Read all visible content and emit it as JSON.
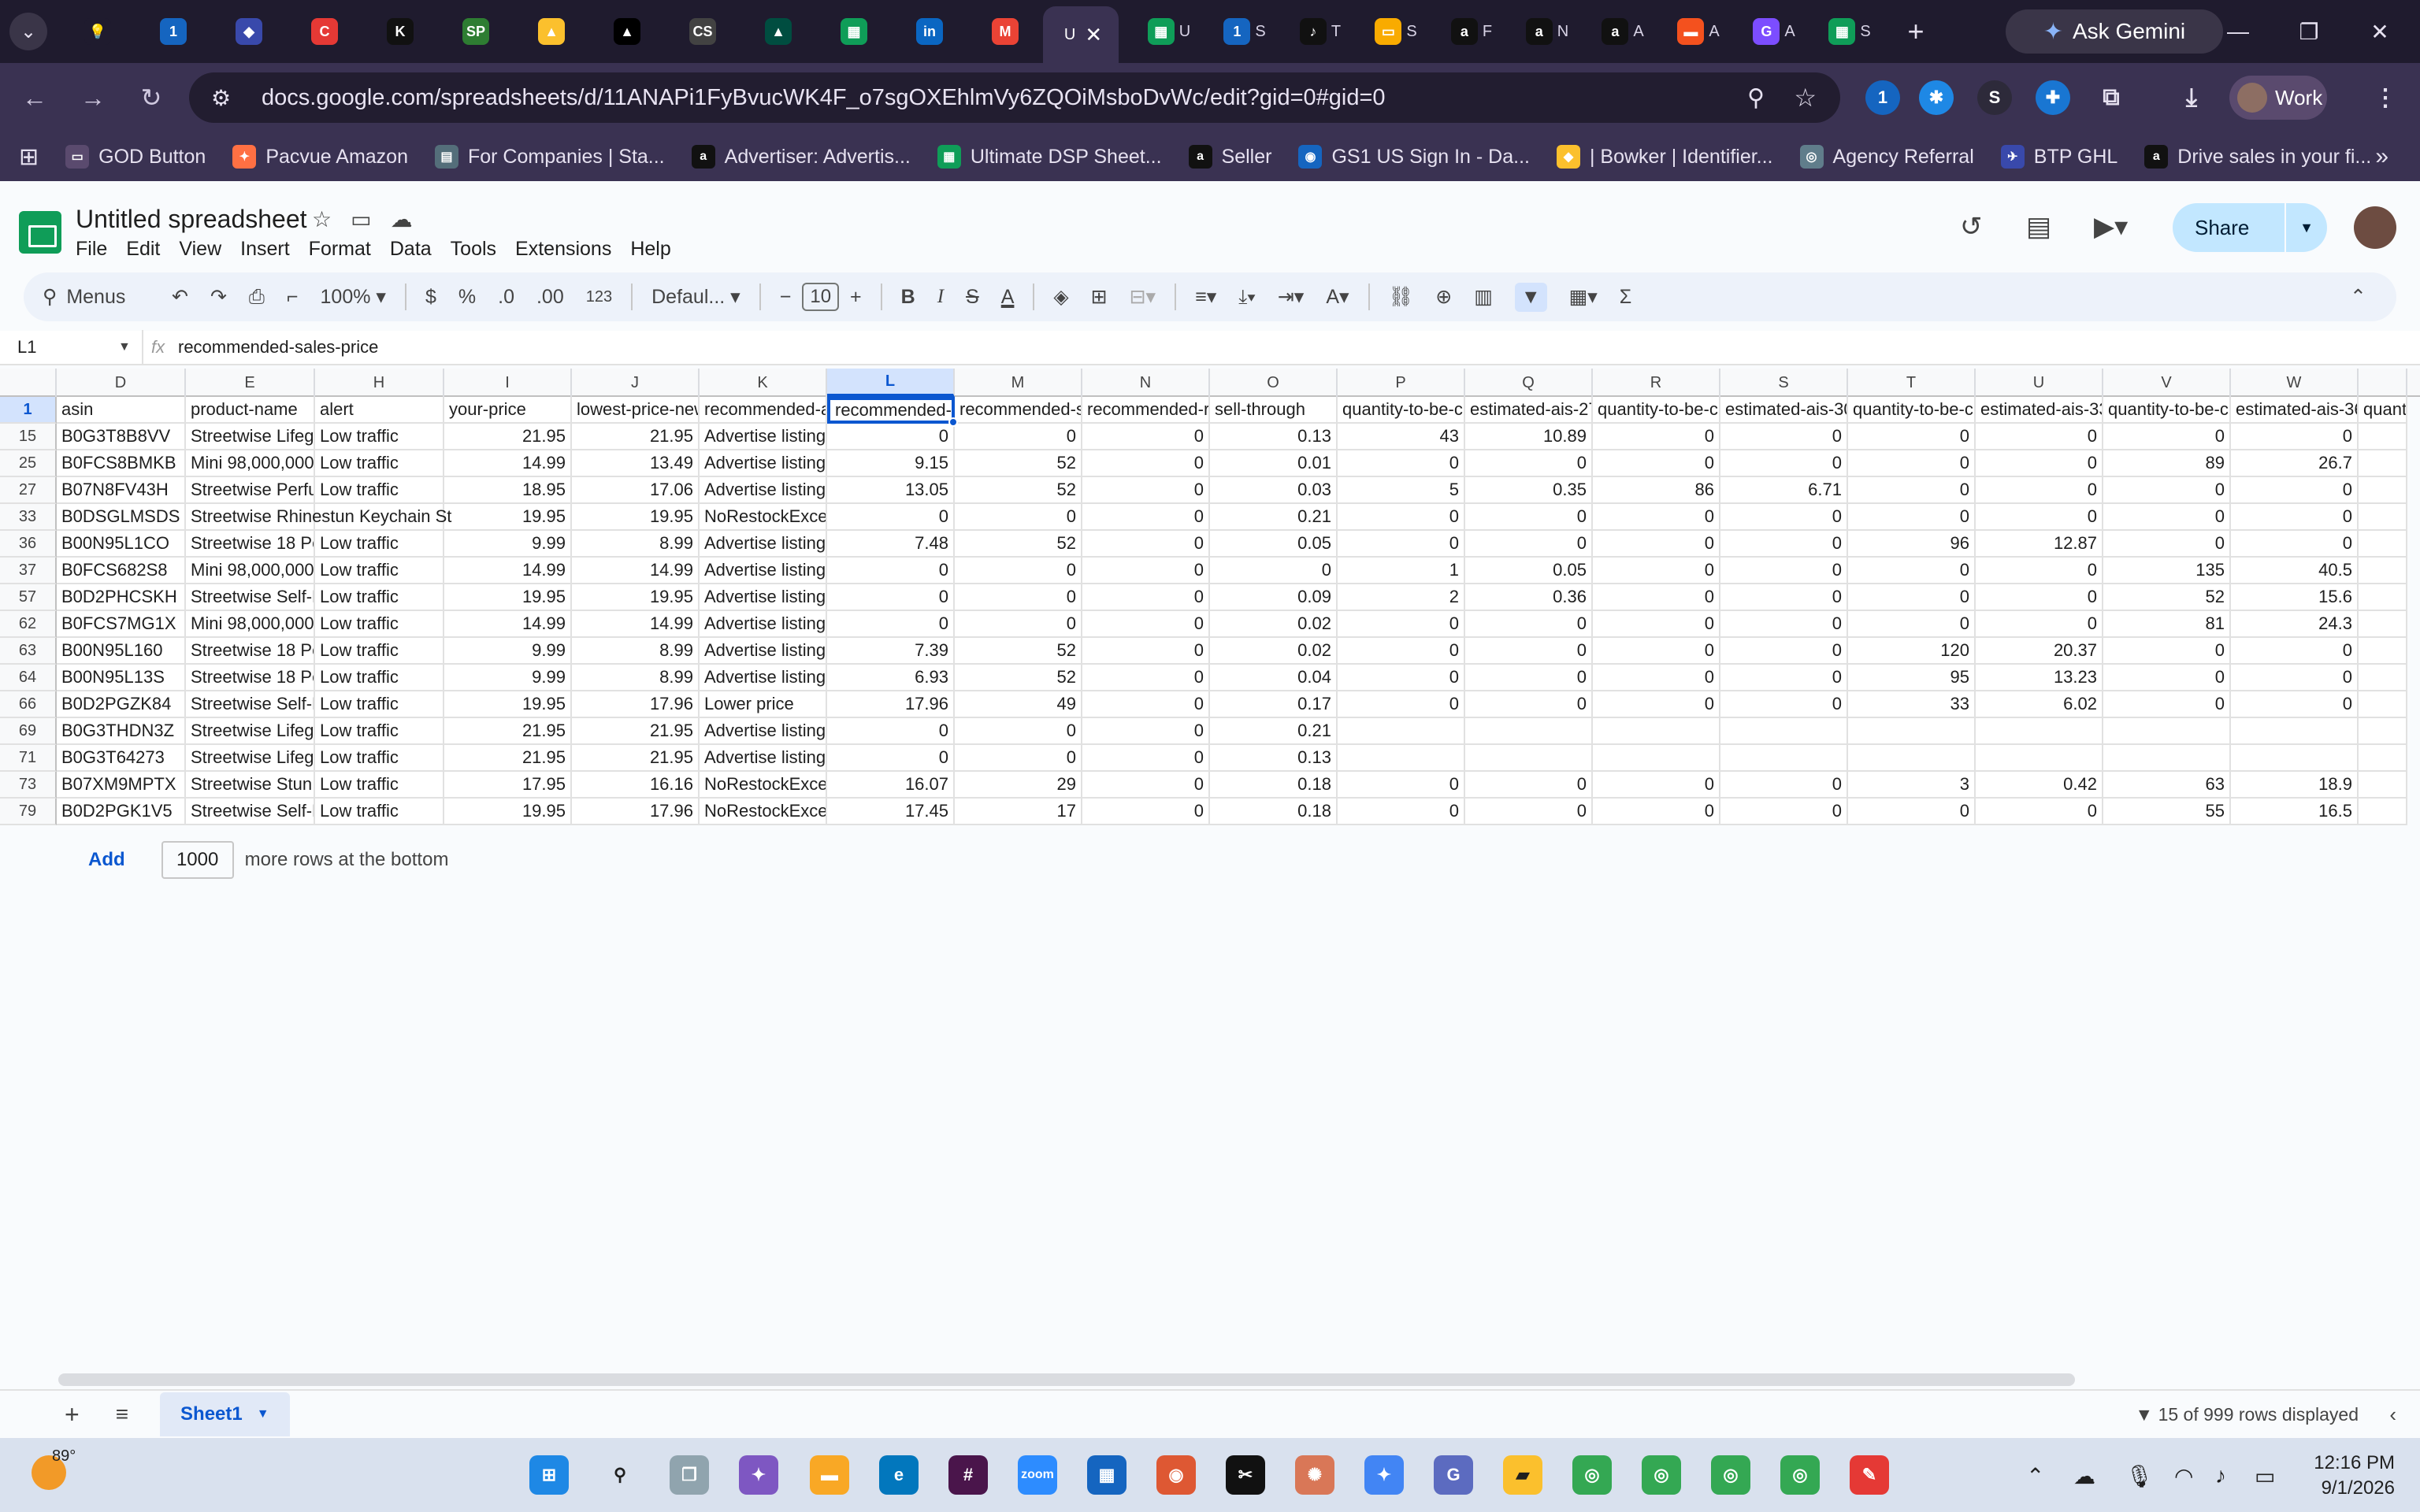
{
  "browser": {
    "tabs": [
      {
        "fav": "💡",
        "bg": "#1f1b2e",
        "title": ""
      },
      {
        "fav": "1",
        "bg": "#1565c0",
        "title": ""
      },
      {
        "fav": "◆",
        "bg": "#3949ab",
        "title": ""
      },
      {
        "fav": "C",
        "bg": "#e53935",
        "title": ""
      },
      {
        "fav": "K",
        "bg": "#111111",
        "title": ""
      },
      {
        "fav": "SP",
        "bg": "#2e7d32",
        "title": ""
      },
      {
        "fav": "▲",
        "bg": "#fbc02d",
        "title": ""
      },
      {
        "fav": "▲",
        "bg": "#000000",
        "title": ""
      },
      {
        "fav": "CS",
        "bg": "#424242",
        "title": ""
      },
      {
        "fav": "▲",
        "bg": "#004d40",
        "title": ""
      },
      {
        "fav": "▦",
        "bg": "#0f9d58",
        "title": ""
      },
      {
        "fav": "in",
        "bg": "#0a66c2",
        "title": ""
      },
      {
        "fav": "M",
        "bg": "#ea4335",
        "title": ""
      }
    ],
    "active_tab": {
      "title": "U",
      "close": "✕"
    },
    "tabs_after": [
      {
        "fav": "▦",
        "bg": "#0f9d58",
        "title": "U"
      },
      {
        "fav": "1",
        "bg": "#1565c0",
        "title": "S"
      },
      {
        "fav": "♪",
        "bg": "#111111",
        "title": "T"
      },
      {
        "fav": "▭",
        "bg": "#f9ab00",
        "title": "S"
      },
      {
        "fav": "a",
        "bg": "#111111",
        "title": "F"
      },
      {
        "fav": "a",
        "bg": "#111111",
        "title": "N"
      },
      {
        "fav": "a",
        "bg": "#111111",
        "title": "A"
      },
      {
        "fav": "▬",
        "bg": "#f4511e",
        "title": "A"
      },
      {
        "fav": "G",
        "bg": "#7c4dff",
        "title": "A"
      },
      {
        "fav": "▦",
        "bg": "#0f9d58",
        "title": "S"
      }
    ],
    "new_tab": "+",
    "ask_gemini": "Ask Gemini",
    "url": "docs.google.com/spreadsheets/d/11ANAPi1FyBvucWK4F_o7sgOXEhlmVy6ZQOiMsboDvWc/edit?gid=0#gid=0",
    "profile": "Work",
    "bookmarks": [
      {
        "label": "GOD Button",
        "bg": "#5a4a6e",
        "icon": "▭"
      },
      {
        "label": "Pacvue Amazon",
        "bg": "#ff7043",
        "icon": "✦"
      },
      {
        "label": "For Companies | Sta...",
        "bg": "#546e7a",
        "icon": "▤"
      },
      {
        "label": "Advertiser: Advertis...",
        "bg": "#111111",
        "icon": "a"
      },
      {
        "label": "Ultimate DSP Sheet...",
        "bg": "#0f9d58",
        "icon": "▦"
      },
      {
        "label": "Seller",
        "bg": "#111111",
        "icon": "a"
      },
      {
        "label": "GS1 US Sign In - Da...",
        "bg": "#1565c0",
        "icon": "◉"
      },
      {
        "label": "| Bowker | Identifier...",
        "bg": "#fbc02d",
        "icon": "◆"
      },
      {
        "label": "Agency Referral",
        "bg": "#607d8b",
        "icon": "◎"
      },
      {
        "label": "BTP GHL",
        "bg": "#3949ab",
        "icon": "✈"
      },
      {
        "label": "Drive sales in your fi...",
        "bg": "#111111",
        "icon": "a"
      }
    ]
  },
  "sheets": {
    "title": "Untitled spreadsheet",
    "menu": [
      "File",
      "Edit",
      "View",
      "Insert",
      "Format",
      "Data",
      "Tools",
      "Extensions",
      "Help"
    ],
    "share": "Share",
    "toolbar": {
      "menus": "Menus",
      "zoom": "100%",
      "currency": "$",
      "percent": "%",
      "dec_decrease": ".0",
      "dec_increase": ".00",
      "number_format": "123",
      "font": "Defaul...",
      "font_size": "10",
      "bold": "B",
      "italic": "I",
      "strike": "S",
      "text_color": "A"
    },
    "name_box": "L1",
    "fx": "fx",
    "formula": "recommended-sales-price",
    "columns": [
      {
        "letter": "D",
        "w": 164
      },
      {
        "letter": "E",
        "w": 164
      },
      {
        "letter": "H",
        "w": 164
      },
      {
        "letter": "I",
        "w": 162
      },
      {
        "letter": "J",
        "w": 162
      },
      {
        "letter": "K",
        "w": 162
      },
      {
        "letter": "L",
        "w": 162
      },
      {
        "letter": "M",
        "w": 162
      },
      {
        "letter": "N",
        "w": 162
      },
      {
        "letter": "O",
        "w": 162
      },
      {
        "letter": "P",
        "w": 162
      },
      {
        "letter": "Q",
        "w": 162
      },
      {
        "letter": "R",
        "w": 162
      },
      {
        "letter": "S",
        "w": 162
      },
      {
        "letter": "T",
        "w": 162
      },
      {
        "letter": "U",
        "w": 162
      },
      {
        "letter": "V",
        "w": 162
      },
      {
        "letter": "W",
        "w": 162
      },
      {
        "letter": "",
        "w": 62
      }
    ],
    "numeric_cols": [
      3,
      4,
      6,
      7,
      8,
      9,
      10,
      11,
      12,
      13,
      14,
      15,
      16,
      17
    ],
    "header_row": {
      "num": "1",
      "cells": [
        "asin",
        "product-name",
        "alert",
        "your-price",
        "lowest-price-new",
        "recommended-a",
        "recommended-s",
        "recommended-sa",
        "recommended-re",
        "sell-through",
        "quantity-to-be-ch",
        "estimated-ais-27",
        "quantity-to-be-ch",
        "estimated-ais-30",
        "quantity-to-be-ch",
        "estimated-ais-33",
        "quantity-to-be-ch",
        "estimated-ais-36",
        "quanti"
      ]
    },
    "rows": [
      {
        "num": "15",
        "cells": [
          "B0G3T8B8VV",
          "Streetwise Lifegu",
          "Low traffic",
          "21.95",
          "21.95",
          "Advertise listing",
          "0",
          "0",
          "0",
          "0.13",
          "43",
          "10.89",
          "0",
          "0",
          "0",
          "0",
          "0",
          "0",
          ""
        ]
      },
      {
        "num": "25",
        "cells": [
          "B0FCS8BMKB",
          "Mini 98,000,000",
          "Low traffic",
          "14.99",
          "13.49",
          "Advertise listing",
          "9.15",
          "52",
          "0",
          "0.01",
          "0",
          "0",
          "0",
          "0",
          "0",
          "0",
          "89",
          "26.7",
          ""
        ]
      },
      {
        "num": "27",
        "cells": [
          "B07N8FV43H",
          "Streetwise Perfu",
          "Low traffic",
          "18.95",
          "17.06",
          "Advertise listing",
          "13.05",
          "52",
          "0",
          "0.03",
          "5",
          "0.35",
          "86",
          "6.71",
          "0",
          "0",
          "0",
          "0",
          ""
        ]
      },
      {
        "num": "33",
        "cells": [
          "B0DSGLMSDS",
          "Streetwise Rhinestun Keychain St",
          "",
          "19.95",
          "19.95",
          "NoRestockExces",
          "0",
          "0",
          "0",
          "0.21",
          "0",
          "0",
          "0",
          "0",
          "0",
          "0",
          "0",
          "0",
          ""
        ]
      },
      {
        "num": "36",
        "cells": [
          "B00N95L1CO",
          "Streetwise 18 Pe",
          "Low traffic",
          "9.99",
          "8.99",
          "Advertise listing",
          "7.48",
          "52",
          "0",
          "0.05",
          "0",
          "0",
          "0",
          "0",
          "96",
          "12.87",
          "0",
          "0",
          ""
        ]
      },
      {
        "num": "37",
        "cells": [
          "B0FCS682S8",
          "Mini 98,000,000",
          "Low traffic",
          "14.99",
          "14.99",
          "Advertise listing",
          "0",
          "0",
          "0",
          "0",
          "1",
          "0.05",
          "0",
          "0",
          "0",
          "0",
          "135",
          "40.5",
          ""
        ]
      },
      {
        "num": "57",
        "cells": [
          "B0D2PHCSKH",
          "Streetwise Self-F",
          "Low traffic",
          "19.95",
          "19.95",
          "Advertise listing",
          "0",
          "0",
          "0",
          "0.09",
          "2",
          "0.36",
          "0",
          "0",
          "0",
          "0",
          "52",
          "15.6",
          ""
        ]
      },
      {
        "num": "62",
        "cells": [
          "B0FCS7MG1X",
          "Mini 98,000,000",
          "Low traffic",
          "14.99",
          "14.99",
          "Advertise listing",
          "0",
          "0",
          "0",
          "0.02",
          "0",
          "0",
          "0",
          "0",
          "0",
          "0",
          "81",
          "24.3",
          ""
        ]
      },
      {
        "num": "63",
        "cells": [
          "B00N95L160",
          "Streetwise 18 Pe",
          "Low traffic",
          "9.99",
          "8.99",
          "Advertise listing",
          "7.39",
          "52",
          "0",
          "0.02",
          "0",
          "0",
          "0",
          "0",
          "120",
          "20.37",
          "0",
          "0",
          ""
        ]
      },
      {
        "num": "64",
        "cells": [
          "B00N95L13S",
          "Streetwise 18 Pe",
          "Low traffic",
          "9.99",
          "8.99",
          "Advertise listing",
          "6.93",
          "52",
          "0",
          "0.04",
          "0",
          "0",
          "0",
          "0",
          "95",
          "13.23",
          "0",
          "0",
          ""
        ]
      },
      {
        "num": "66",
        "cells": [
          "B0D2PGZK84",
          "Streetwise Self-F",
          "Low traffic",
          "19.95",
          "17.96",
          "Lower price",
          "17.96",
          "49",
          "0",
          "0.17",
          "0",
          "0",
          "0",
          "0",
          "33",
          "6.02",
          "0",
          "0",
          ""
        ]
      },
      {
        "num": "69",
        "cells": [
          "B0G3THDN3Z",
          "Streetwise Lifegu",
          "Low traffic",
          "21.95",
          "21.95",
          "Advertise listing",
          "0",
          "0",
          "0",
          "0.21",
          "",
          "",
          "",
          "",
          "",
          "",
          "",
          "",
          ""
        ]
      },
      {
        "num": "71",
        "cells": [
          "B0G3T64273",
          "Streetwise Lifegu",
          "Low traffic",
          "21.95",
          "21.95",
          "Advertise listing",
          "0",
          "0",
          "0",
          "0.13",
          "",
          "",
          "",
          "",
          "",
          "",
          "",
          "",
          ""
        ]
      },
      {
        "num": "73",
        "cells": [
          "B07XM9MPTX",
          "Streetwise Stun",
          "Low traffic",
          "17.95",
          "16.16",
          "NoRestockExces",
          "16.07",
          "29",
          "0",
          "0.18",
          "0",
          "0",
          "0",
          "0",
          "3",
          "0.42",
          "63",
          "18.9",
          ""
        ]
      },
      {
        "num": "79",
        "cells": [
          "B0D2PGK1V5",
          "Streetwise Self-D",
          "Low traffic",
          "19.95",
          "17.96",
          "NoRestockExces",
          "17.45",
          "17",
          "0",
          "0.18",
          "0",
          "0",
          "0",
          "0",
          "0",
          "0",
          "55",
          "16.5",
          ""
        ]
      }
    ],
    "add_rows": {
      "button": "Add",
      "count": "1000",
      "suffix": "more rows at the bottom"
    },
    "sheet_tab": "Sheet1",
    "rows_displayed": "15 of 999 rows displayed"
  },
  "taskbar": {
    "temperature": "89°",
    "time": "12:16 PM",
    "date": "9/1/2026"
  }
}
